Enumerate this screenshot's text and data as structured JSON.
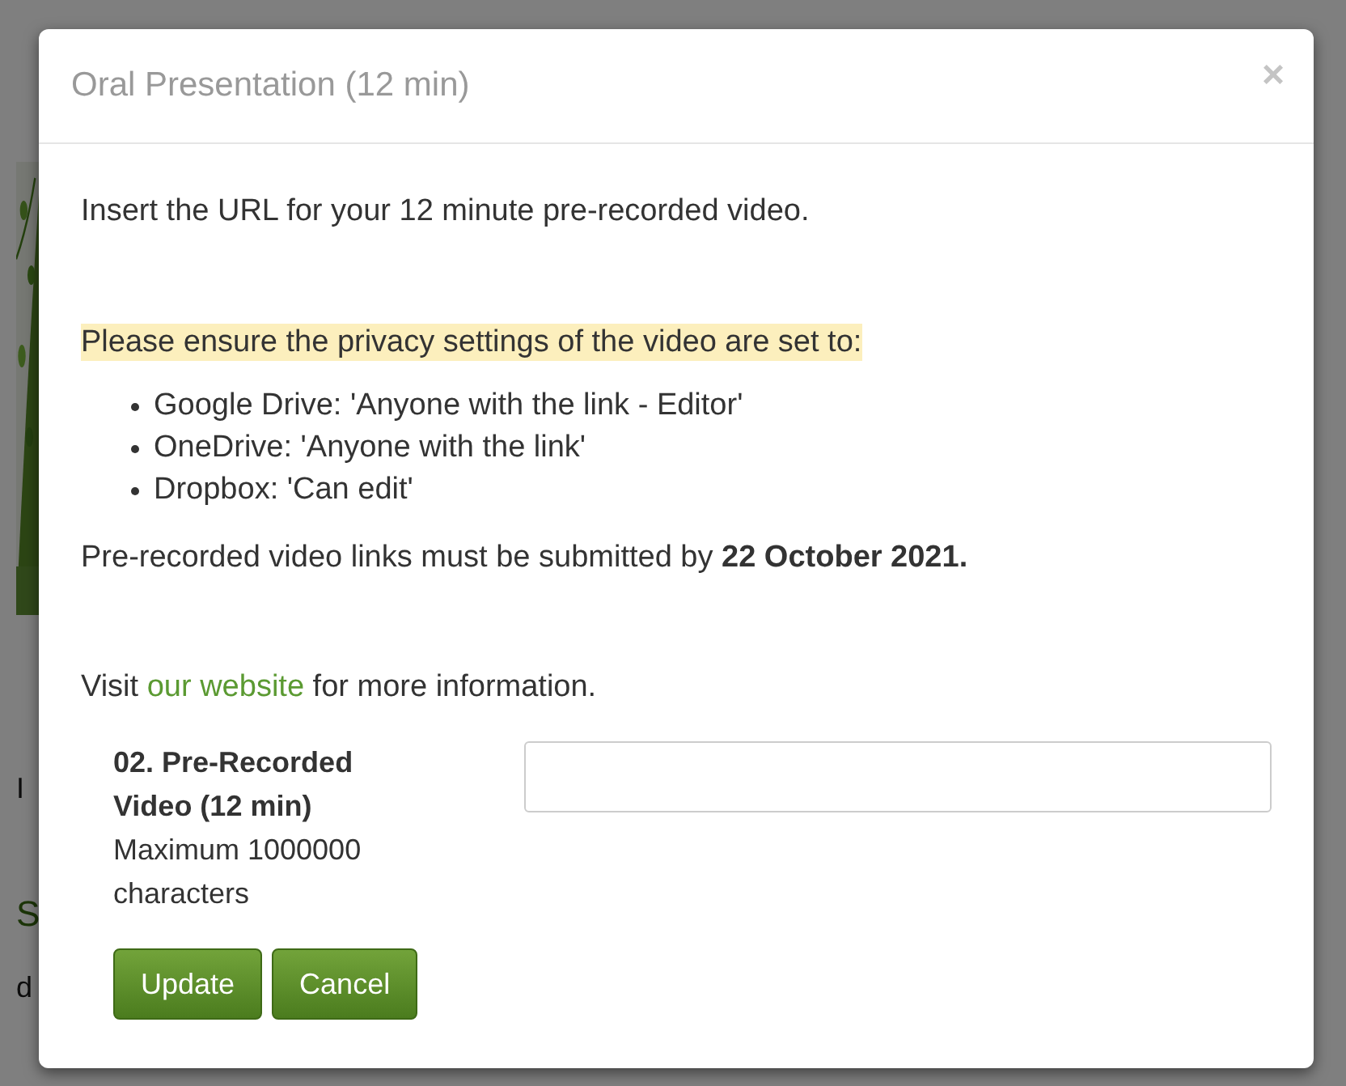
{
  "background": {
    "fragments": [
      {
        "text": "I",
        "kind": "plain"
      },
      {
        "text": "S",
        "kind": "heading"
      },
      {
        "text": "d",
        "kind": "plain"
      }
    ]
  },
  "modal": {
    "title": "Oral Presentation (12 min)",
    "close": "×",
    "intro": "Insert the URL for your 12 minute pre-recorded video.",
    "notice": "Please ensure the privacy settings of the video are set to:",
    "list": [
      "Google Drive:  'Anyone with the link - Editor'",
      "OneDrive: 'Anyone with the link'",
      "Dropbox: 'Can edit'"
    ],
    "deadline": "Pre-recorded video links must be submitted by **22 October 2021.**",
    "info": {
      "before": "Visit ",
      "link": "our website",
      "after": " for more information."
    },
    "field": {
      "label": "02. Pre-Recorded Video (12 min)",
      "hint": "Maximum 1000000 characters"
    },
    "buttons": [
      "Update",
      "Cancel"
    ]
  }
}
